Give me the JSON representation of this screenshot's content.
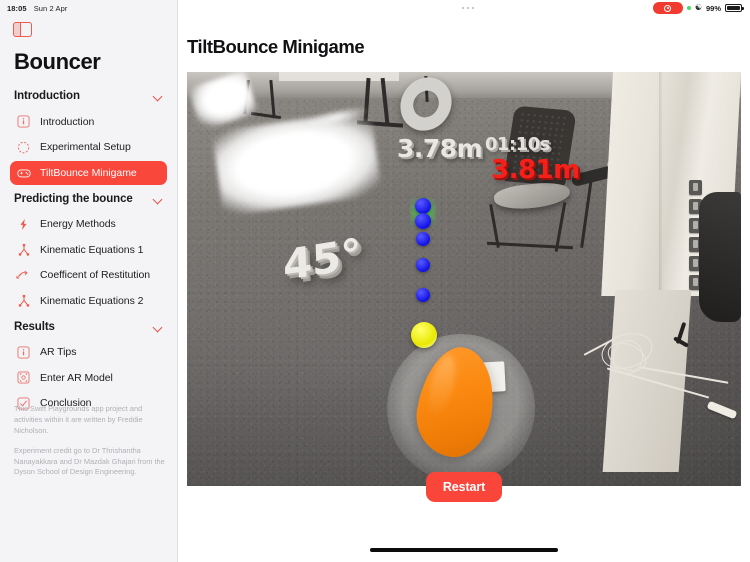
{
  "status_bar": {
    "time": "18:05",
    "date": "Sun 2 Apr",
    "battery_percent": "99%",
    "wifi_icon": "wifi-icon",
    "location_icon": "location-dot-icon",
    "screen_record_icon": "screen-record-icon"
  },
  "sidebar": {
    "toggle_icon": "sidebar-toggle-icon",
    "app_title": "Bouncer",
    "sections": [
      {
        "label": "Introduction",
        "chevron_icon": "chevron-down-icon",
        "items": [
          {
            "label": "Introduction",
            "icon": "info-square-icon",
            "active": false
          },
          {
            "label": "Experimental Setup",
            "icon": "dashed-circle-icon",
            "active": false
          },
          {
            "label": "TiltBounce Minigame",
            "icon": "gamecontroller-icon",
            "active": true
          }
        ]
      },
      {
        "label": "Predicting the bounce",
        "chevron_icon": "chevron-down-icon",
        "items": [
          {
            "label": "Energy Methods",
            "icon": "bolt-icon",
            "active": false
          },
          {
            "label": "Kinematic Equations 1",
            "icon": "point-topleft-down-curvedto-point-icon",
            "active": false
          },
          {
            "label": "Coefficent of Restitution",
            "icon": "arrow-bounce-icon",
            "active": false
          },
          {
            "label": "Kinematic Equations 2",
            "icon": "point-topleft-down-curvedto-point-icon",
            "active": false
          }
        ]
      },
      {
        "label": "Results",
        "chevron_icon": "chevron-down-icon",
        "items": [
          {
            "label": "AR Tips",
            "icon": "info-square-icon",
            "active": false
          },
          {
            "label": "Enter AR Model",
            "icon": "arkit-square-icon",
            "active": false
          },
          {
            "label": "Conclusion",
            "icon": "checkmark-square-icon",
            "active": false
          }
        ]
      }
    ],
    "footer": [
      "This Swift Playgrounds app project and activities within it are written by Freddie Nicholson.",
      "Experiment credit go to Dr Thrishantha Nanayakkara and Dr Mazdak Ghajari from the Dyson School of Design Engineering."
    ]
  },
  "main": {
    "overflow_icon": "ellipsis-icon",
    "page_title": "TiltBounce Minigame",
    "ar_view": {
      "target_ring_icon": "ar-target-ring",
      "distance_label": "3.78m",
      "timer_label": "01:10s",
      "highlight_distance_label": "3.81m",
      "angle_label": "45°"
    },
    "restart_button": "Restart"
  },
  "colors": {
    "accent": "#f9473c",
    "accent_button": "#f9453a",
    "sidebar_bg": "#f4f3f5",
    "text_primary": "#111114",
    "footer_text": "#b2b0b6",
    "ar_red_text": "#f6201b",
    "trajectory_dot": "#1111e8",
    "ball": "#e8e800",
    "paddle": "#ef7c06",
    "bounce_marker": "#3ceb3c"
  }
}
